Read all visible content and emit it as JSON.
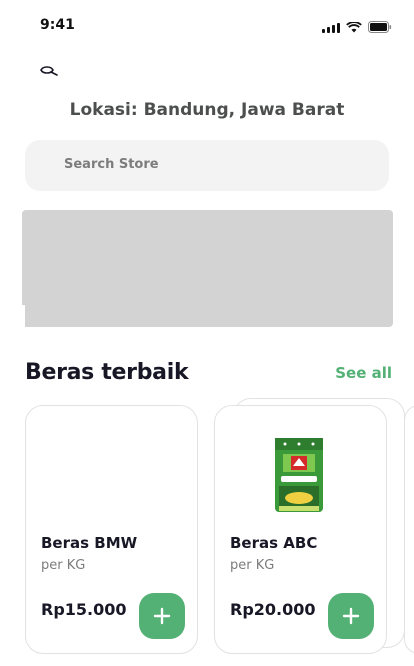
{
  "status_bar": {
    "time": "9:41",
    "icons": [
      "cellular-signal-icon",
      "wifi-icon",
      "battery-icon"
    ]
  },
  "header": {
    "logo_icon": "carrot-logo-icon",
    "location": "Lokasi: Bandung, Jawa Barat"
  },
  "search": {
    "placeholder": "Search Store"
  },
  "banner": {
    "color": "#d3d3d3"
  },
  "section": {
    "title": "Beras terbaik",
    "see_all": "See all"
  },
  "products": [
    {
      "name": "Beras BMW",
      "unit": "per KG",
      "price": "Rp15.000",
      "image": "none"
    },
    {
      "name": "Beras ABC",
      "unit": "per KG",
      "price": "Rp20.000",
      "image": "rice-bag-image"
    }
  ],
  "colors": {
    "accent": "#53b175",
    "text": "#181725",
    "muted": "#7c7c7c",
    "search_bg": "#f2f3f2"
  }
}
